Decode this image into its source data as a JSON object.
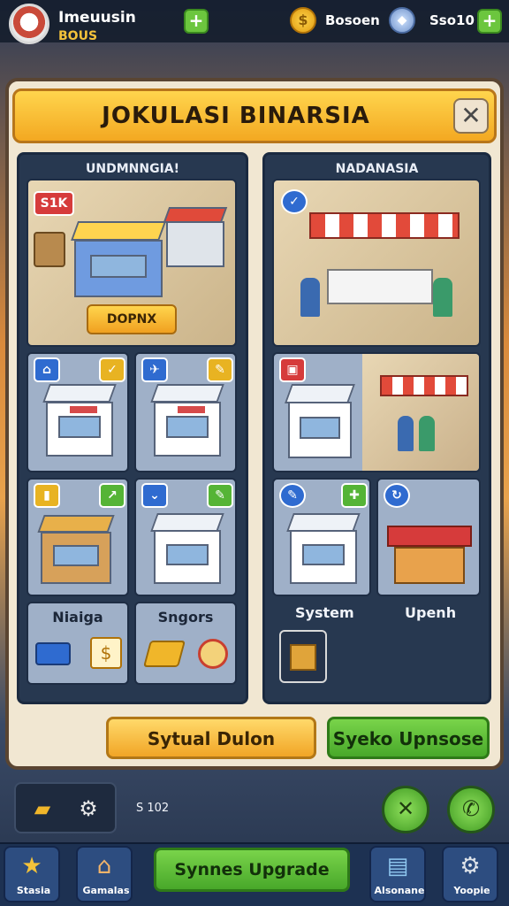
{
  "topbar": {
    "player_name": "Imeuusin",
    "player_tag": "BOUS",
    "plus_label": "+",
    "coin_symbol": "$",
    "coin_label": "Bosoen",
    "gem_symbol": "◆",
    "gem_label": "Sso10"
  },
  "dialog": {
    "title": "JOKULASI BINARSIA",
    "close_symbol": "✕"
  },
  "left_column": {
    "header": "UNDMNNGIA!",
    "featured_badge": "S1K",
    "featured_button": "DOPNX",
    "card_labels": [
      "Niaiga",
      "Sngors"
    ]
  },
  "right_column": {
    "header": "NADANASIA",
    "card_labels": [
      "System",
      "Upenh"
    ]
  },
  "actions": {
    "yellow_button": "Sytual Dulon",
    "green_button": "Syeko Upnsose"
  },
  "footer": {
    "counter": "S 102"
  },
  "bottom_nav": {
    "items": [
      {
        "label": "Stasia",
        "icon": "★"
      },
      {
        "label": "Gamalas",
        "icon": "⌂"
      },
      {
        "label": "Alsonane",
        "icon": "▤"
      },
      {
        "label": "Yoopie",
        "icon": "⚙"
      }
    ],
    "center_button": "Synnes Upgrade"
  },
  "colors": {
    "accent_yellow": "#f3a821",
    "accent_green": "#48a82a",
    "panel_navy": "#273850"
  }
}
